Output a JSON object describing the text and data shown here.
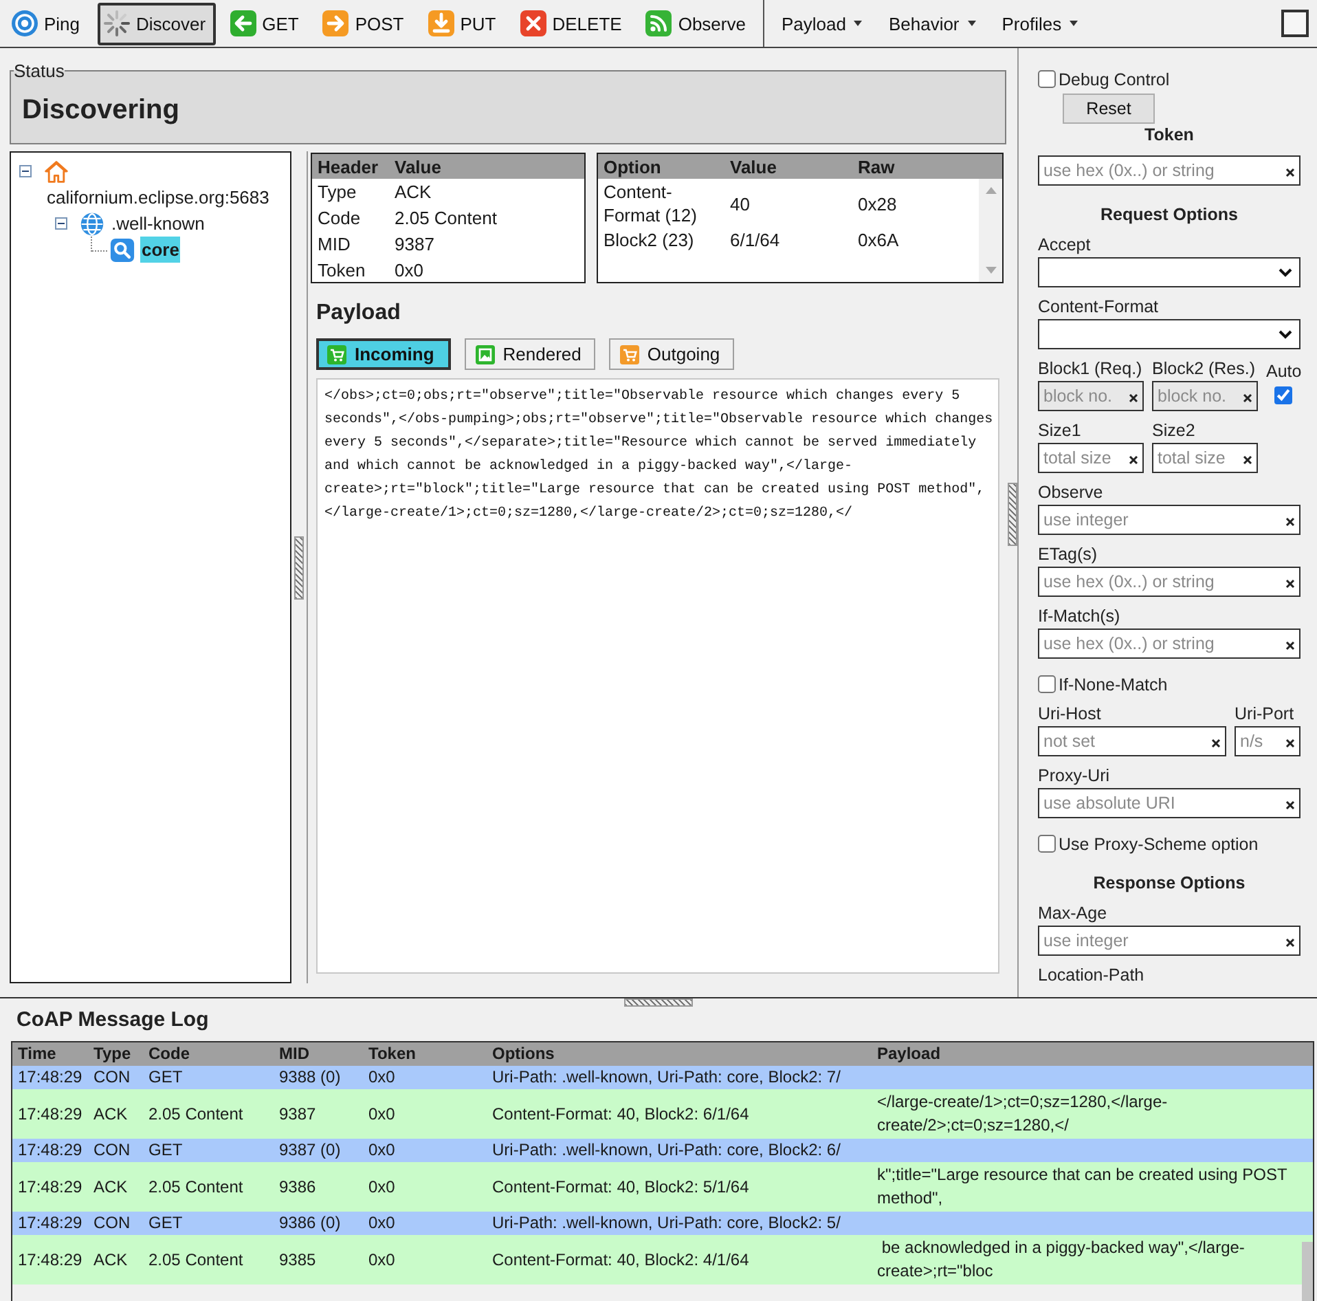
{
  "toolbar": {
    "buttons": [
      {
        "label": "Ping",
        "kind": "ping",
        "selected": false
      },
      {
        "label": "Discover",
        "kind": "discover",
        "selected": true
      },
      {
        "label": "GET",
        "kind": "get",
        "selected": false
      },
      {
        "label": "POST",
        "kind": "post",
        "selected": false
      },
      {
        "label": "PUT",
        "kind": "put",
        "selected": false
      },
      {
        "label": "DELETE",
        "kind": "delete",
        "selected": false
      },
      {
        "label": "Observe",
        "kind": "observe",
        "selected": false
      }
    ],
    "menus": [
      {
        "label": "Payload"
      },
      {
        "label": "Behavior"
      },
      {
        "label": "Profiles"
      }
    ],
    "toggle": {
      "checked": false
    }
  },
  "status": {
    "legend": "Status",
    "text": "Discovering"
  },
  "tree": [
    {
      "label": "californium.eclipse.org:5683",
      "kind": "host",
      "expanded": true,
      "selected": false,
      "children": [
        {
          "label": ".well-known",
          "kind": "folder",
          "expanded": true,
          "selected": false,
          "children": [
            {
              "label": "core",
              "kind": "resource",
              "selected": true
            }
          ]
        }
      ]
    }
  ],
  "header_table": {
    "columns": [
      "Header",
      "Value"
    ],
    "rows": [
      [
        "Type",
        "ACK"
      ],
      [
        "Code",
        "2.05 Content"
      ],
      [
        "MID",
        "9387"
      ],
      [
        "Token",
        "0x0"
      ]
    ]
  },
  "options_table": {
    "columns": [
      "Option",
      "Value",
      "Raw"
    ],
    "rows": [
      [
        "Content-Format (12)",
        "40",
        "0x28"
      ],
      [
        "Block2 (23)",
        "6/1/64",
        "0x6A"
      ]
    ]
  },
  "payload": {
    "title": "Payload",
    "tabs": [
      {
        "label": "Incoming",
        "kind": "incoming",
        "selected": true
      },
      {
        "label": "Rendered",
        "kind": "rendered",
        "selected": false
      },
      {
        "label": "Outgoing",
        "kind": "outgoing",
        "selected": false
      }
    ],
    "text": "</obs>;ct=0;obs;rt=\"observe\";title=\"Observable resource which changes every 5 seconds\",</obs-pumping>;obs;rt=\"observe\";title=\"Observable resource which changes every 5 seconds\",</separate>;title=\"Resource which cannot be served immediately and which cannot be acknowledged in a piggy-backed way\",</large-create>;rt=\"block\";title=\"Large resource that can be created using POST method\",</large-create/1>;ct=0;sz=1280,</large-create/2>;ct=0;sz=1280,</"
  },
  "side_panel": {
    "items": [
      {
        "kind": "checkbox",
        "label": "Debug Control",
        "checked": false
      },
      {
        "kind": "button",
        "label": "Reset"
      },
      {
        "kind": "heading",
        "label": "Token"
      },
      {
        "kind": "field",
        "placeholder": "use hex (0x..) or string"
      },
      {
        "kind": "heading",
        "label": "Request Options"
      },
      {
        "kind": "select",
        "label": "Accept"
      },
      {
        "kind": "select",
        "label": "Content-Format"
      },
      {
        "kind": "pair",
        "fields": [
          {
            "label": "Block1 (Req.)",
            "placeholder": "block no.",
            "disabled": true
          },
          {
            "label": "Block2 (Res.)",
            "placeholder": "block no.",
            "disabled": true
          }
        ],
        "check": {
          "label": "Auto",
          "checked": true
        }
      },
      {
        "kind": "pair",
        "fields": [
          {
            "label": "Size1",
            "placeholder": "total size",
            "disabled": false
          },
          {
            "label": "Size2",
            "placeholder": "total size",
            "disabled": false
          }
        ]
      },
      {
        "kind": "field",
        "label": "Observe",
        "placeholder": "use integer"
      },
      {
        "kind": "field",
        "label": "ETag(s)",
        "placeholder": "use hex (0x..) or string"
      },
      {
        "kind": "field",
        "label": "If-Match(s)",
        "placeholder": "use hex (0x..) or string"
      },
      {
        "kind": "checkbox",
        "label": "If-None-Match",
        "checked": false
      },
      {
        "kind": "host_port",
        "fields": [
          {
            "label": "Uri-Host",
            "placeholder": "not set",
            "disabled": false
          },
          {
            "label": "Uri-Port",
            "placeholder": "n/s",
            "disabled": false
          }
        ]
      },
      {
        "kind": "field",
        "label": "Proxy-Uri",
        "placeholder": "use absolute URI"
      },
      {
        "kind": "checkbox",
        "label": "Use Proxy-Scheme option",
        "checked": false
      },
      {
        "kind": "heading",
        "label": "Response Options"
      },
      {
        "kind": "field",
        "label": "Max-Age",
        "placeholder": "use integer"
      },
      {
        "kind": "label",
        "label": "Location-Path"
      }
    ]
  },
  "log": {
    "title": "CoAP Message Log",
    "columns": [
      "Time",
      "Type",
      "Code",
      "MID",
      "Token",
      "Options",
      "Payload"
    ],
    "rows": [
      {
        "kind": "con",
        "time": "17:48:29",
        "type": "CON",
        "code": "GET",
        "mid": "9388 (0)",
        "token": "0x0",
        "options": "Uri-Path: .well-known, Uri-Path: core, Block2: 7/"
      },
      {
        "kind": "ack",
        "time": "17:48:29",
        "type": "ACK",
        "code": "2.05 Content",
        "mid": "9387",
        "token": "0x0",
        "options": "Content-Format: 40, Block2: 6/1/64",
        "payload": "</large-create/1>;ct=0;sz=1280,</large-create/2>;ct=0;sz=1280,</"
      },
      {
        "kind": "con",
        "time": "17:48:29",
        "type": "CON",
        "code": "GET",
        "mid": "9387 (0)",
        "token": "0x0",
        "options": "Uri-Path: .well-known, Uri-Path: core, Block2: 6/"
      },
      {
        "kind": "ack",
        "time": "17:48:29",
        "type": "ACK",
        "code": "2.05 Content",
        "mid": "9386",
        "token": "0x0",
        "options": "Content-Format: 40, Block2: 5/1/64",
        "payload": "k\";title=\"Large resource that can be created using POST method\","
      },
      {
        "kind": "con",
        "time": "17:48:29",
        "type": "CON",
        "code": "GET",
        "mid": "9386 (0)",
        "token": "0x0",
        "options": "Uri-Path: .well-known, Uri-Path: core, Block2: 5/"
      },
      {
        "kind": "ack",
        "time": "17:48:29",
        "type": "ACK",
        "code": "2.05 Content",
        "mid": "9385",
        "token": "0x0",
        "options": "Content-Format: 40, Block2: 4/1/64",
        "payload": " be acknowledged in a piggy-backed way\",</large-create>;rt=\"bloc"
      }
    ]
  }
}
